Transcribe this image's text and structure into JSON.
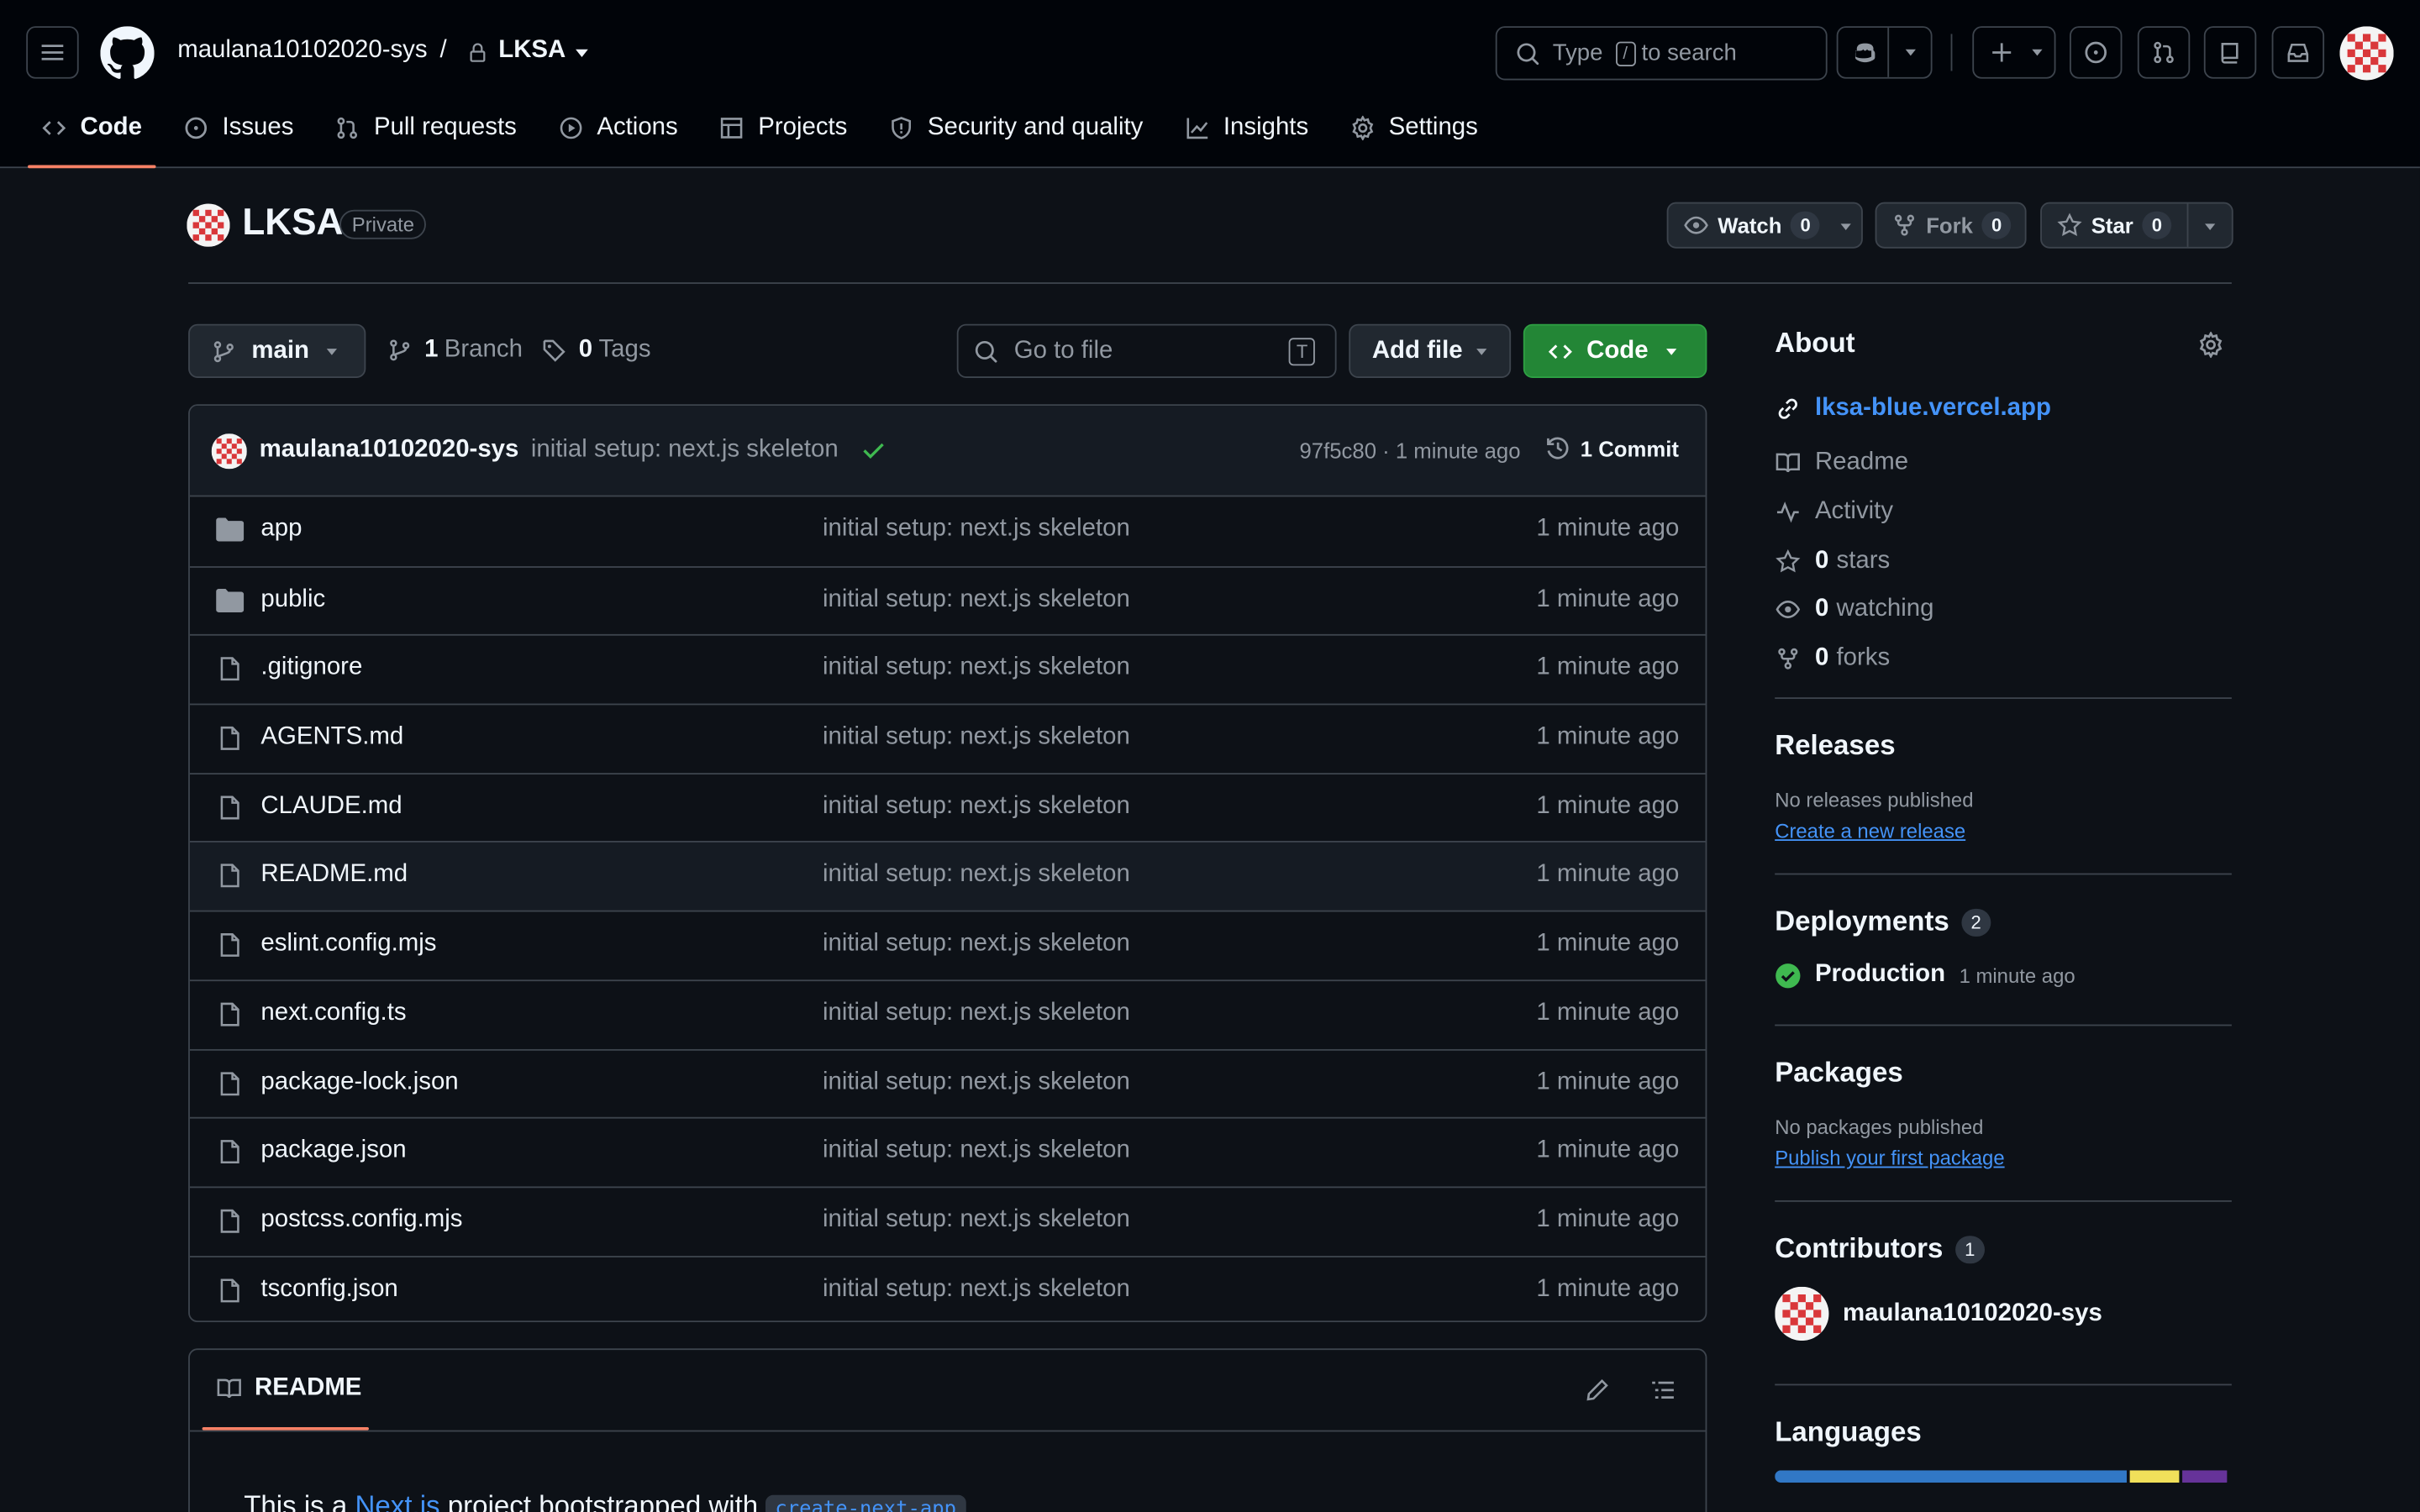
{
  "header": {
    "owner": "maulana10102020-sys",
    "separator": "/",
    "repo": "LKSA",
    "search_prefix": "Type",
    "search_key": "/",
    "search_suffix": "to search"
  },
  "tabs": [
    {
      "label": "Code",
      "icon": "code-icon"
    },
    {
      "label": "Issues",
      "icon": "issue-icon"
    },
    {
      "label": "Pull requests",
      "icon": "pull-request-icon"
    },
    {
      "label": "Actions",
      "icon": "play-icon"
    },
    {
      "label": "Projects",
      "icon": "table-icon"
    },
    {
      "label": "Security and quality",
      "icon": "shield-icon"
    },
    {
      "label": "Insights",
      "icon": "graph-icon"
    },
    {
      "label": "Settings",
      "icon": "gear-icon"
    }
  ],
  "repo": {
    "name": "LKSA",
    "visibility": "Private",
    "watch_label": "Watch",
    "watch_count": "0",
    "fork_label": "Fork",
    "fork_count": "0",
    "star_label": "Star",
    "star_count": "0"
  },
  "toolbar": {
    "branch": "main",
    "branch_count": "1",
    "branch_label": "Branch",
    "tag_count": "0",
    "tag_label": "Tags",
    "goto_placeholder": "Go to file",
    "goto_key": "T",
    "add_file": "Add file",
    "code": "Code"
  },
  "commit": {
    "author": "maulana10102020-sys",
    "message": "initial setup: next.js skeleton",
    "hash_time": "97f5c80 · 1 minute ago",
    "commits_label": "1 Commit"
  },
  "files": [
    {
      "name": "app",
      "type": "dir",
      "message": "initial setup: next.js skeleton",
      "date": "1 minute ago"
    },
    {
      "name": "public",
      "type": "dir",
      "message": "initial setup: next.js skeleton",
      "date": "1 minute ago"
    },
    {
      "name": ".gitignore",
      "type": "file",
      "message": "initial setup: next.js skeleton",
      "date": "1 minute ago"
    },
    {
      "name": "AGENTS.md",
      "type": "file",
      "message": "initial setup: next.js skeleton",
      "date": "1 minute ago"
    },
    {
      "name": "CLAUDE.md",
      "type": "file",
      "message": "initial setup: next.js skeleton",
      "date": "1 minute ago"
    },
    {
      "name": "README.md",
      "type": "file",
      "message": "initial setup: next.js skeleton",
      "date": "1 minute ago"
    },
    {
      "name": "eslint.config.mjs",
      "type": "file",
      "message": "initial setup: next.js skeleton",
      "date": "1 minute ago"
    },
    {
      "name": "next.config.ts",
      "type": "file",
      "message": "initial setup: next.js skeleton",
      "date": "1 minute ago"
    },
    {
      "name": "package-lock.json",
      "type": "file",
      "message": "initial setup: next.js skeleton",
      "date": "1 minute ago"
    },
    {
      "name": "package.json",
      "type": "file",
      "message": "initial setup: next.js skeleton",
      "date": "1 minute ago"
    },
    {
      "name": "postcss.config.mjs",
      "type": "file",
      "message": "initial setup: next.js skeleton",
      "date": "1 minute ago"
    },
    {
      "name": "tsconfig.json",
      "type": "file",
      "message": "initial setup: next.js skeleton",
      "date": "1 minute ago"
    }
  ],
  "readme": {
    "tab": "README",
    "text_before": "This is a",
    "link": "Next.js",
    "text_after": "project bootstrapped with",
    "code": "create-next-app"
  },
  "about": {
    "title": "About",
    "website": "lksa-blue.vercel.app",
    "readme": "Readme",
    "activity": "Activity",
    "stars_count": "0",
    "stars_label": "stars",
    "watching_count": "0",
    "watching_label": "watching",
    "forks_count": "0",
    "forks_label": "forks"
  },
  "releases": {
    "title": "Releases",
    "none": "No releases published",
    "link": "Create a new release"
  },
  "deployments": {
    "title": "Deployments",
    "count": "2",
    "env": "Production",
    "time": "1 minute ago"
  },
  "packages": {
    "title": "Packages",
    "none": "No packages published",
    "link": "Publish your first package"
  },
  "contributors": {
    "title": "Contributors",
    "count": "1",
    "name": "maulana10102020-sys"
  },
  "languages": {
    "title": "Languages",
    "bars": [
      {
        "fraction": 0.78,
        "color": "#3178c6"
      },
      {
        "fraction": 0.11,
        "color": "#f1e05a"
      },
      {
        "fraction": 0.1,
        "color": "#663399"
      }
    ]
  },
  "colors": {
    "accent": "#f78166",
    "primary_button": "#238636",
    "link": "#4493f8",
    "success": "#3fb950"
  }
}
